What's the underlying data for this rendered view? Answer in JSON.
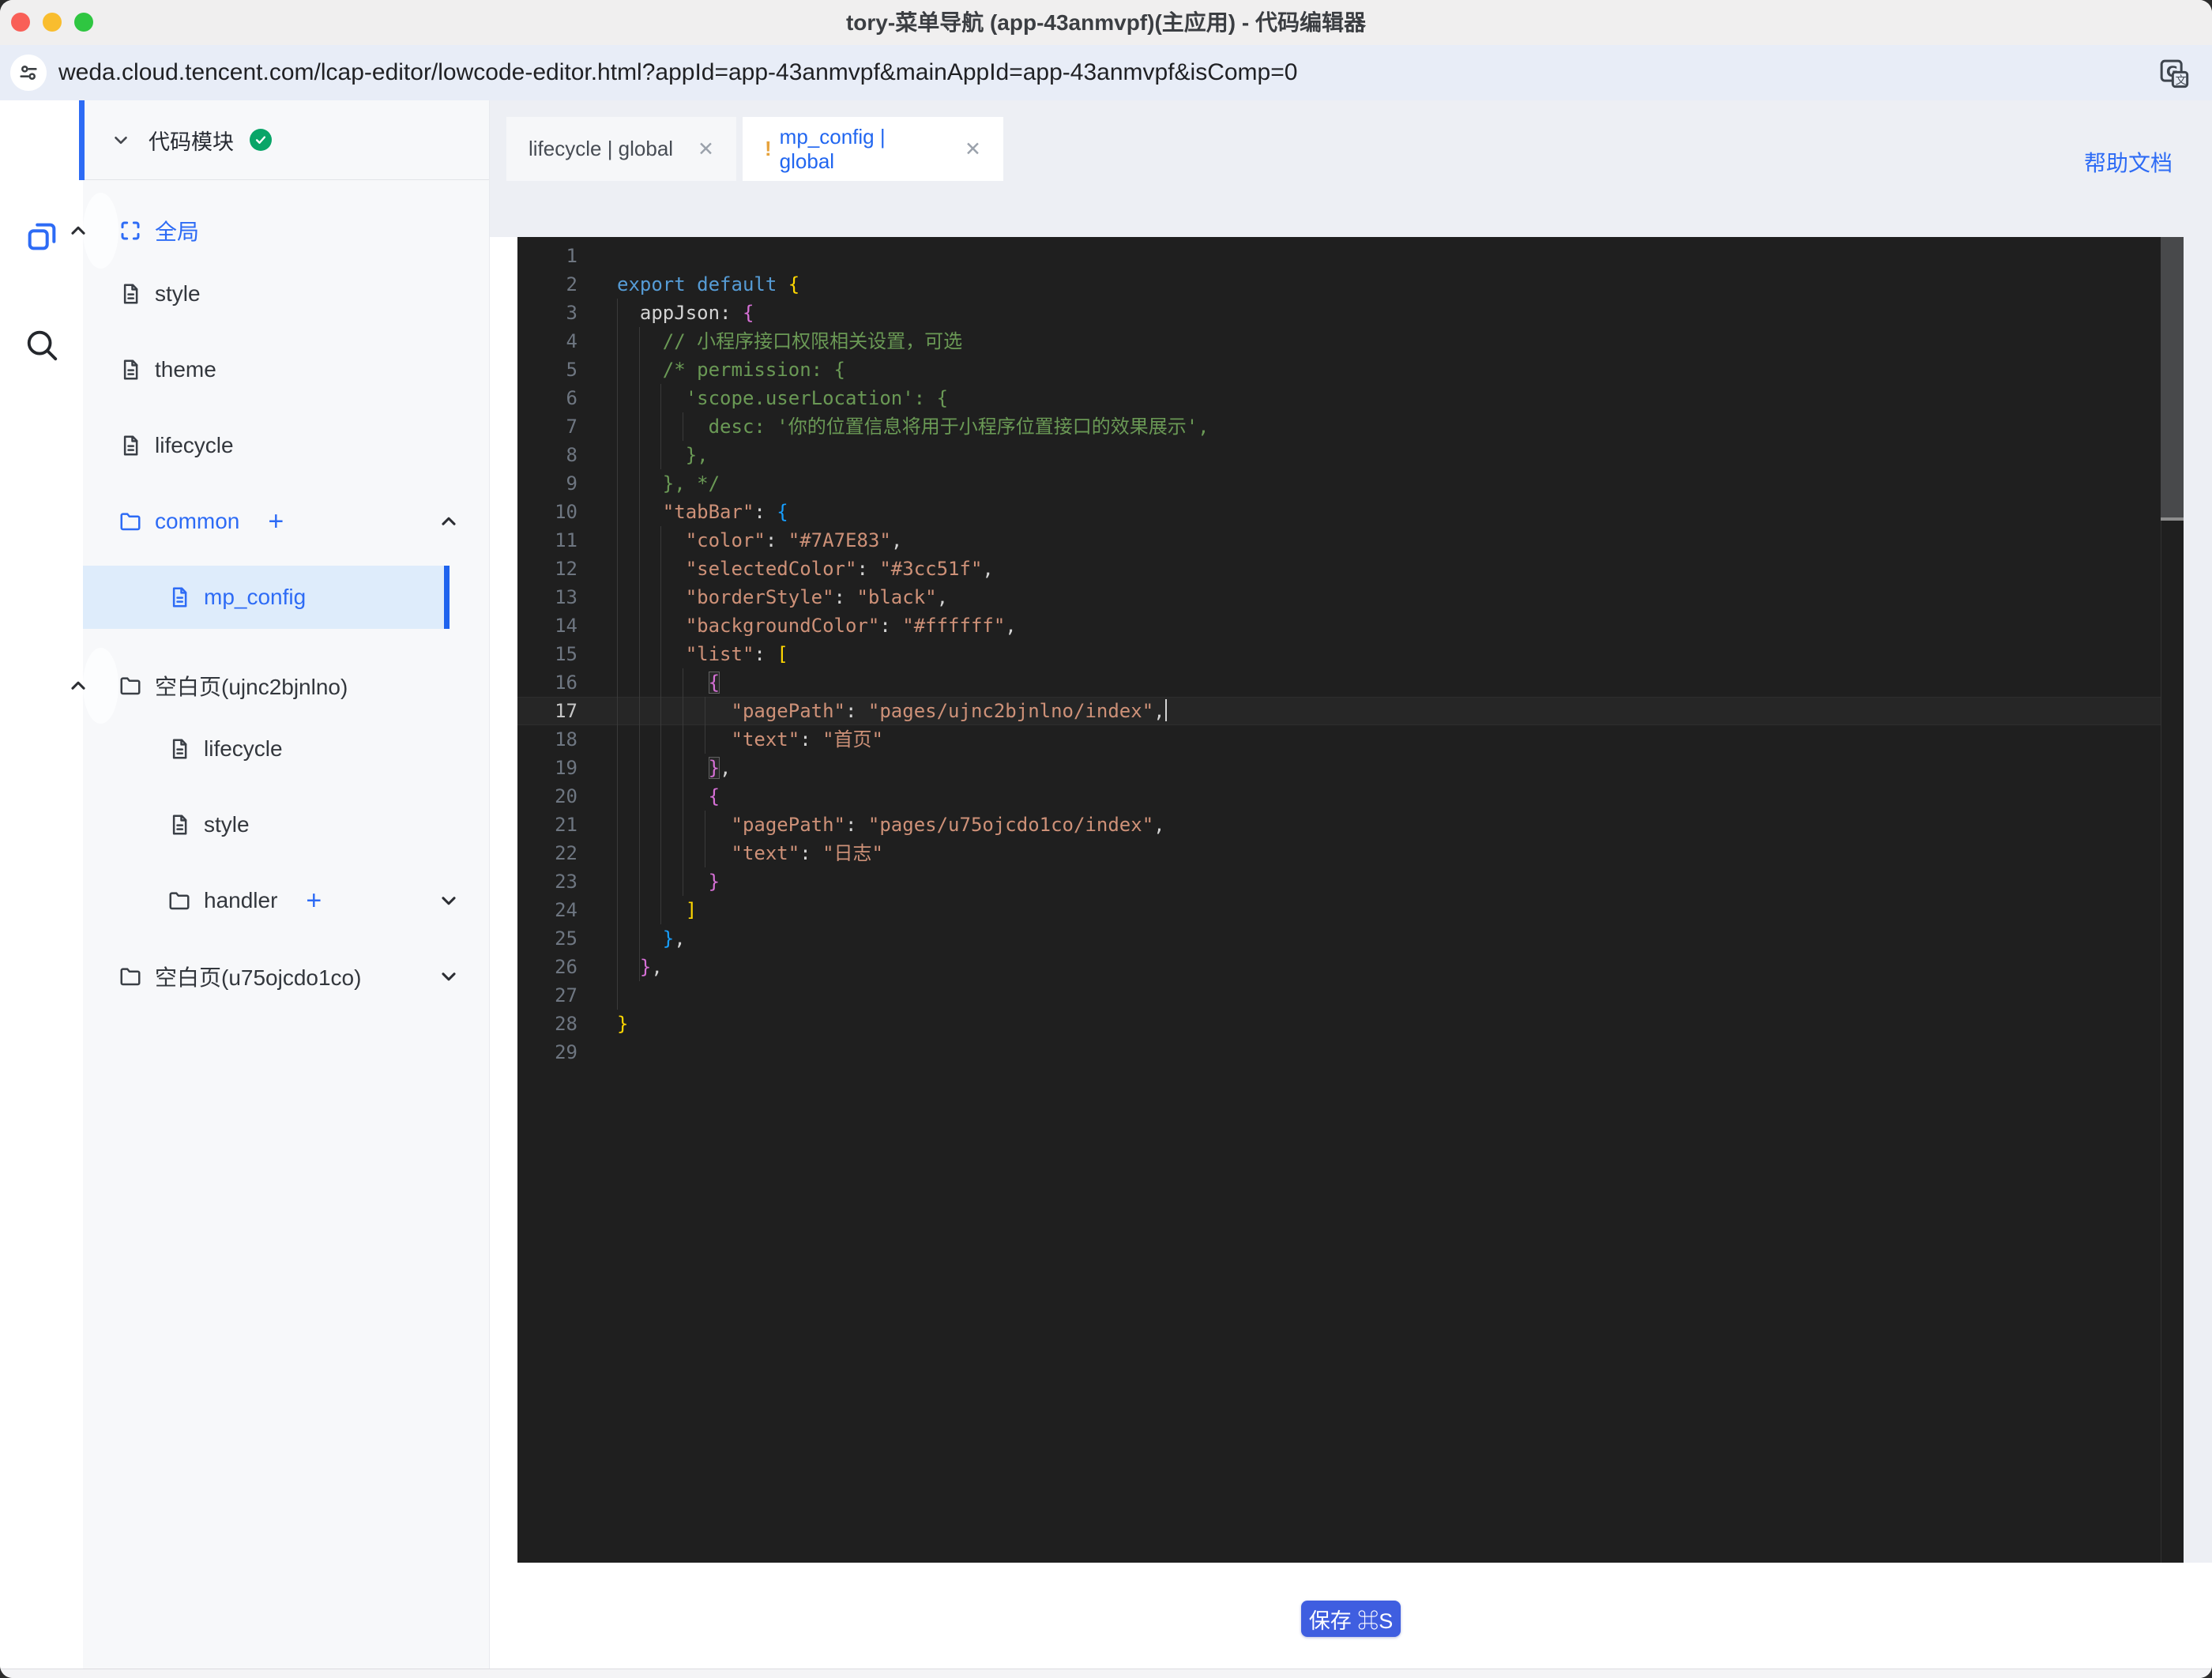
{
  "window": {
    "title": "tory-菜单导航 (app-43anmvpf)(主应用) - 代码编辑器"
  },
  "browser": {
    "url": "weda.cloud.tencent.com/lcap-editor/lowcode-editor.html?appId=app-43anmvpf&mainAppId=app-43anmvpf&isComp=0"
  },
  "colors": {
    "accent_blue": "#2d6bf5",
    "save_blue": "#3f5ee0",
    "badge_green": "#09a568",
    "selected_row_bg": "#deecfb",
    "editor_bg": "#1f1f1f",
    "tab_modified_orange": "#e6a23c"
  },
  "sidebar": {
    "header": {
      "label": "代码模块",
      "status_icon": "check-badge"
    },
    "items": [
      {
        "label": "全局",
        "icon": "scan",
        "blue": true,
        "chevron": "up",
        "indent": 0,
        "light": true
      },
      {
        "label": "style",
        "icon": "file",
        "indent": 0
      },
      {
        "label": "theme",
        "icon": "file",
        "indent": 0
      },
      {
        "label": "lifecycle",
        "icon": "file",
        "indent": 0
      },
      {
        "label": "common",
        "icon": "folder",
        "blue": true,
        "plus": "+",
        "chevron": "up",
        "indent": 0
      },
      {
        "label": "mp_config",
        "icon": "file",
        "blue": true,
        "selected": true,
        "indent": 1
      },
      {
        "label": "空白页(ujnc2bjnlno)",
        "icon": "folder",
        "chevron": "up",
        "indent": 0,
        "light": true
      },
      {
        "label": "lifecycle",
        "icon": "file",
        "indent": 1
      },
      {
        "label": "style",
        "icon": "file",
        "indent": 1
      },
      {
        "label": "handler",
        "icon": "folder",
        "plus": "+",
        "chevron": "down",
        "indent": 1
      },
      {
        "label": "空白页(u75ojcdo1co)",
        "icon": "folder",
        "chevron": "down",
        "indent": 0
      }
    ]
  },
  "tabs": [
    {
      "label": "lifecycle | global",
      "active": false,
      "close": "✕"
    },
    {
      "prefix": "!",
      "label": "mp_config | global",
      "active": true,
      "close": "✕"
    }
  ],
  "help_link": "帮助文档",
  "editor": {
    "active_line": 17,
    "lines": [
      {
        "n": 1,
        "tokens": []
      },
      {
        "n": 2,
        "tokens": [
          [
            "kw",
            "export default"
          ],
          [
            "plain",
            " "
          ],
          [
            "br1",
            "{"
          ]
        ]
      },
      {
        "n": 3,
        "tokens": [
          [
            "plain",
            "  appJson"
          ],
          [
            "punct",
            ":"
          ],
          [
            "plain",
            " "
          ],
          [
            "br2",
            "{"
          ]
        ]
      },
      {
        "n": 4,
        "tokens": [
          [
            "plain",
            "    "
          ],
          [
            "comment",
            "// 小程序接口权限相关设置，可选"
          ]
        ]
      },
      {
        "n": 5,
        "tokens": [
          [
            "comment",
            "    /* permission: {"
          ]
        ]
      },
      {
        "n": 6,
        "tokens": [
          [
            "comment",
            "      'scope.userLocation': {"
          ]
        ]
      },
      {
        "n": 7,
        "tokens": [
          [
            "comment",
            "        desc: '你的位置信息将用于小程序位置接口的效果展示',"
          ]
        ]
      },
      {
        "n": 8,
        "tokens": [
          [
            "comment",
            "      },"
          ]
        ]
      },
      {
        "n": 9,
        "tokens": [
          [
            "comment",
            "    }, */"
          ]
        ]
      },
      {
        "n": 10,
        "tokens": [
          [
            "plain",
            "    "
          ],
          [
            "key",
            "\"tabBar\""
          ],
          [
            "punct",
            ": "
          ],
          [
            "br3",
            "{"
          ]
        ]
      },
      {
        "n": 11,
        "tokens": [
          [
            "plain",
            "      "
          ],
          [
            "key",
            "\"color\""
          ],
          [
            "punct",
            ": "
          ],
          [
            "str",
            "\"#7A7E83\""
          ],
          [
            "punct",
            ","
          ]
        ]
      },
      {
        "n": 12,
        "tokens": [
          [
            "plain",
            "      "
          ],
          [
            "key",
            "\"selectedColor\""
          ],
          [
            "punct",
            ": "
          ],
          [
            "str",
            "\"#3cc51f\""
          ],
          [
            "punct",
            ","
          ]
        ]
      },
      {
        "n": 13,
        "tokens": [
          [
            "plain",
            "      "
          ],
          [
            "key",
            "\"borderStyle\""
          ],
          [
            "punct",
            ": "
          ],
          [
            "str",
            "\"black\""
          ],
          [
            "punct",
            ","
          ]
        ]
      },
      {
        "n": 14,
        "tokens": [
          [
            "plain",
            "      "
          ],
          [
            "key",
            "\"backgroundColor\""
          ],
          [
            "punct",
            ": "
          ],
          [
            "str",
            "\"#ffffff\""
          ],
          [
            "punct",
            ","
          ]
        ]
      },
      {
        "n": 15,
        "tokens": [
          [
            "plain",
            "      "
          ],
          [
            "key",
            "\"list\""
          ],
          [
            "punct",
            ": "
          ],
          [
            "br1",
            "["
          ]
        ]
      },
      {
        "n": 16,
        "tokens": [
          [
            "plain",
            "        "
          ],
          [
            "br2 match",
            "{"
          ]
        ]
      },
      {
        "n": 17,
        "tokens": [
          [
            "plain",
            "          "
          ],
          [
            "key",
            "\"pagePath\""
          ],
          [
            "punct",
            ": "
          ],
          [
            "str",
            "\"pages/ujnc2bjnlno/index\""
          ],
          [
            "punct",
            ","
          ],
          [
            "cursor",
            ""
          ]
        ]
      },
      {
        "n": 18,
        "tokens": [
          [
            "plain",
            "          "
          ],
          [
            "key",
            "\"text\""
          ],
          [
            "punct",
            ": "
          ],
          [
            "str",
            "\"首页\""
          ]
        ]
      },
      {
        "n": 19,
        "tokens": [
          [
            "plain",
            "        "
          ],
          [
            "br2 match",
            "}"
          ],
          [
            "punct",
            ","
          ]
        ]
      },
      {
        "n": 20,
        "tokens": [
          [
            "plain",
            "        "
          ],
          [
            "br2",
            "{"
          ]
        ]
      },
      {
        "n": 21,
        "tokens": [
          [
            "plain",
            "          "
          ],
          [
            "key",
            "\"pagePath\""
          ],
          [
            "punct",
            ": "
          ],
          [
            "str",
            "\"pages/u75ojcdo1co/index\""
          ],
          [
            "punct",
            ","
          ]
        ]
      },
      {
        "n": 22,
        "tokens": [
          [
            "plain",
            "          "
          ],
          [
            "key",
            "\"text\""
          ],
          [
            "punct",
            ": "
          ],
          [
            "str",
            "\"日志\""
          ]
        ]
      },
      {
        "n": 23,
        "tokens": [
          [
            "plain",
            "        "
          ],
          [
            "br2",
            "}"
          ]
        ]
      },
      {
        "n": 24,
        "tokens": [
          [
            "plain",
            "      "
          ],
          [
            "br1",
            "]"
          ]
        ]
      },
      {
        "n": 25,
        "tokens": [
          [
            "plain",
            "    "
          ],
          [
            "br3",
            "}"
          ],
          [
            "punct",
            ","
          ]
        ]
      },
      {
        "n": 26,
        "tokens": [
          [
            "plain",
            "  "
          ],
          [
            "br2",
            "}"
          ],
          [
            "punct",
            ","
          ]
        ]
      },
      {
        "n": 27,
        "tokens": []
      },
      {
        "n": 28,
        "tokens": [
          [
            "br1",
            "}"
          ]
        ]
      },
      {
        "n": 29,
        "tokens": []
      }
    ]
  },
  "save_button": {
    "label": "保存 ⌘S"
  }
}
